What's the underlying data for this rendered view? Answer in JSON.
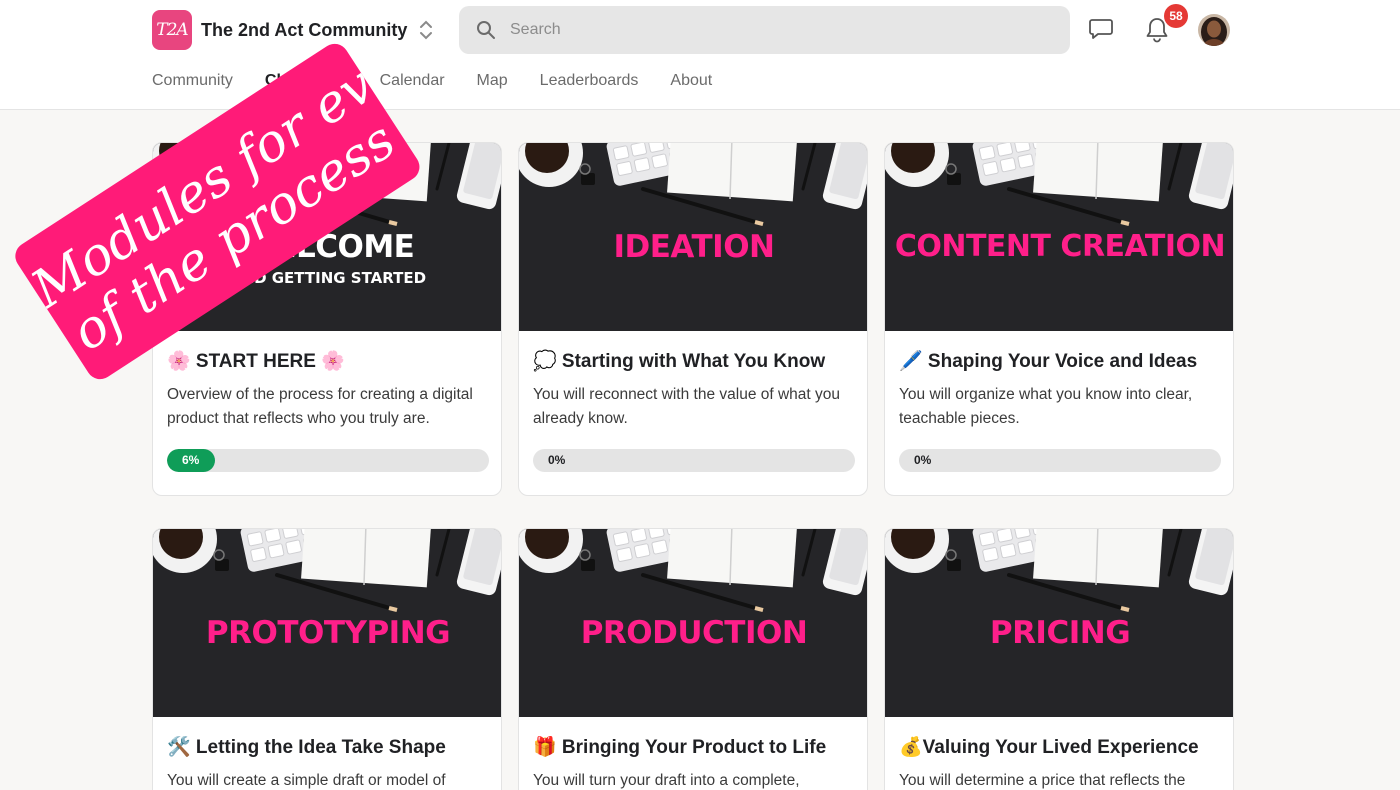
{
  "header": {
    "logo_text": "T2A",
    "community_name": "The 2nd Act Community",
    "search_placeholder": "Search",
    "notification_count": "58",
    "colors": {
      "logo": "#e8457f",
      "badge": "#e53935"
    }
  },
  "nav": {
    "tabs": [
      {
        "label": "Community",
        "active": false
      },
      {
        "label": "Classroom",
        "active": true
      },
      {
        "label": "Calendar",
        "active": false
      },
      {
        "label": "Map",
        "active": false
      },
      {
        "label": "Leaderboards",
        "active": false
      },
      {
        "label": "About",
        "active": false
      }
    ]
  },
  "promo": {
    "line1": "Modules for every step",
    "line2": "of the process",
    "color": "#ff1b78"
  },
  "courses": [
    {
      "cover_title": "WELCOME",
      "cover_subtitle": "AND GETTING STARTED",
      "emoji": "🌸",
      "title": "🌸 START HERE 🌸",
      "description": "Overview of the process for creating a digital product that reflects who you truly are.",
      "progress": 6,
      "progress_label": "6%"
    },
    {
      "cover_title": "IDEATION",
      "title": "💭 Starting with What You Know",
      "description": "You will reconnect with the value of what you already know.",
      "progress": 0,
      "progress_label": "0%"
    },
    {
      "cover_title": "CONTENT CREATION",
      "title": "🖊️ Shaping Your Voice and Ideas",
      "description": "You will organize what you know into clear, teachable pieces.",
      "progress": 0,
      "progress_label": "0%"
    },
    {
      "cover_title": "PROTOTYPING",
      "title": "🛠️ Letting the Idea Take Shape",
      "description": "You will create a simple draft or model of"
    },
    {
      "cover_title": "PRODUCTION",
      "title": "🎁 Bringing Your Product to Life",
      "description": "You will turn your draft into a complete,"
    },
    {
      "cover_title": "PRICING",
      "title": "💰Valuing Your Lived Experience",
      "description": "You will determine a price that reflects the"
    }
  ],
  "colors": {
    "cover_title": "#ff1f8a",
    "progress_fill": "#0f9d58"
  }
}
